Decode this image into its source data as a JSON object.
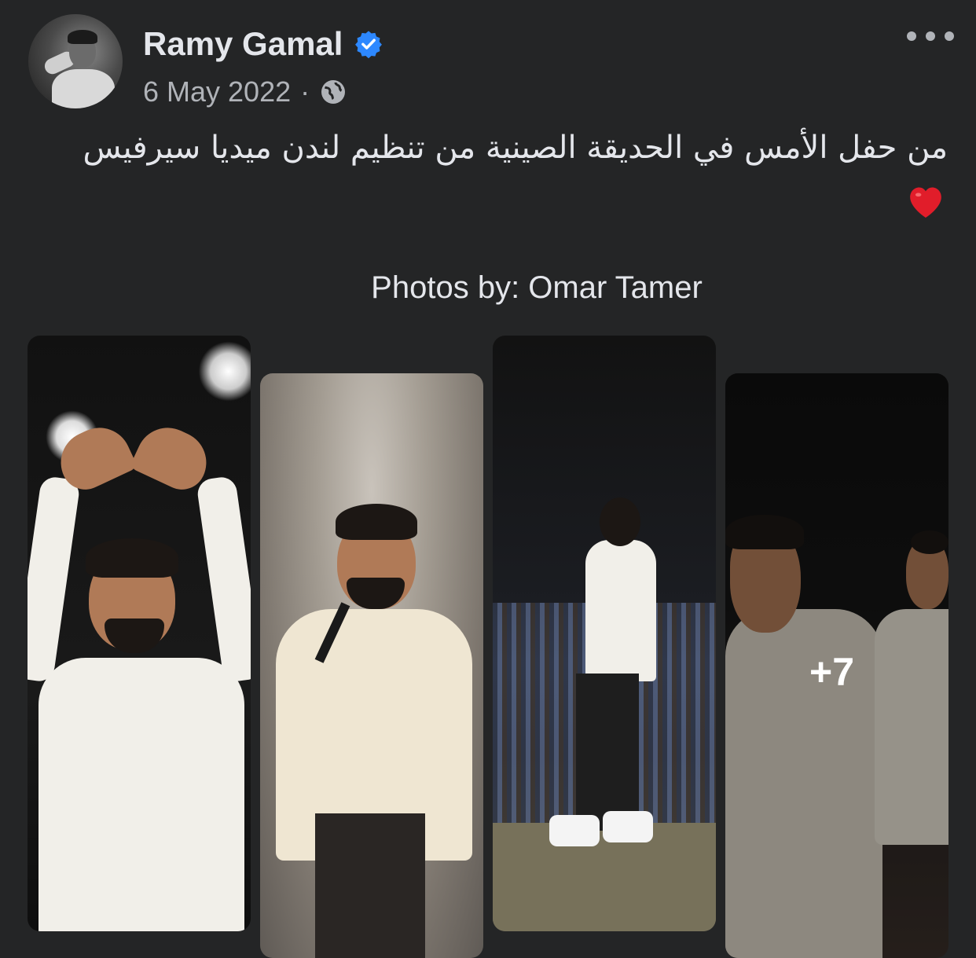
{
  "post": {
    "author": "Ramy Gamal",
    "date": "6 May 2022",
    "separator": "·",
    "text": "من حفل الأمس في الحديقة الصينية من تنظيم لندن ميديا سيرفيس",
    "credit": "Photos by: Omar Tamer",
    "more_photos_label": "+7"
  },
  "colors": {
    "background": "#242526",
    "verified_badge": "#2d88ff",
    "heart": "#e11d2a"
  },
  "icons": [
    "verified-badge-icon",
    "globe-icon",
    "more-options-icon",
    "heart-emoji-icon"
  ]
}
